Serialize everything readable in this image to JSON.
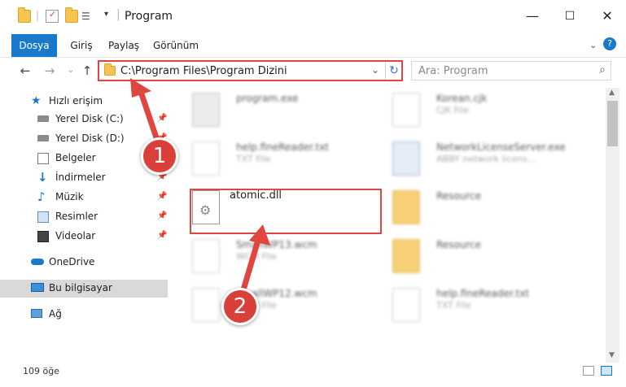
{
  "window": {
    "title": "Program",
    "controls": {
      "minimize": "—",
      "maximize": "☐",
      "close": "✕"
    }
  },
  "ribbon": {
    "tabs": [
      "Dosya",
      "Giriş",
      "Paylaş",
      "Görünüm"
    ],
    "help_glyph": "?"
  },
  "address": {
    "path": "C:\\Program Files\\Program Dizini",
    "search_placeholder": "Ara: Program"
  },
  "sidebar": {
    "items": [
      {
        "label": "Hızlı erişim",
        "icon": "star-icon"
      },
      {
        "label": "Yerel Disk (C:)",
        "icon": "drive-icon",
        "pinned": true
      },
      {
        "label": "Yerel Disk (D:)",
        "icon": "drive-icon",
        "pinned": true
      },
      {
        "label": "Belgeler",
        "icon": "documents-icon",
        "pinned": true
      },
      {
        "label": "İndirmeler",
        "icon": "download-icon",
        "pinned": true
      },
      {
        "label": "Müzik",
        "icon": "music-icon",
        "pinned": true
      },
      {
        "label": "Resimler",
        "icon": "pictures-icon",
        "pinned": true
      },
      {
        "label": "Videolar",
        "icon": "videos-icon",
        "pinned": true
      },
      {
        "label": "OneDrive",
        "icon": "cloud-icon"
      },
      {
        "label": "Bu bilgisayar",
        "icon": "computer-icon",
        "selected": true
      },
      {
        "label": "Ağ",
        "icon": "network-icon"
      }
    ]
  },
  "files": [
    {
      "name": "program.exe",
      "desc": "",
      "icon": "exe-icon"
    },
    {
      "name": "Korean.cjk",
      "desc": "CJK File",
      "icon": "document-icon"
    },
    {
      "name": "help.fineReader.txt",
      "desc": "TXT File",
      "icon": "document-icon"
    },
    {
      "name": "NetworkLicenseServer.exe",
      "desc": "ABBY network licens...",
      "icon": "exe-icon"
    },
    {
      "name": "atomic.dll",
      "desc": "",
      "icon": "dll-icon"
    },
    {
      "name": "Resource",
      "desc": "",
      "icon": "folder-icon"
    },
    {
      "name": "SmallWP13.wcm",
      "desc": "WCM File",
      "icon": "document-icon"
    },
    {
      "name": "Resource",
      "desc": "",
      "icon": "folder-icon"
    },
    {
      "name": "SmallWP12.wcm",
      "desc": "WCM File",
      "icon": "document-icon"
    },
    {
      "name": "help.fineReader.txt",
      "desc": "TXT File",
      "icon": "document-icon"
    }
  ],
  "status": {
    "count": "109 öğe"
  },
  "annotations": {
    "step1": "1",
    "step2": "2"
  },
  "colors": {
    "accent": "#1979ca",
    "highlight": "#e0453f",
    "folder": "#f5c451"
  }
}
